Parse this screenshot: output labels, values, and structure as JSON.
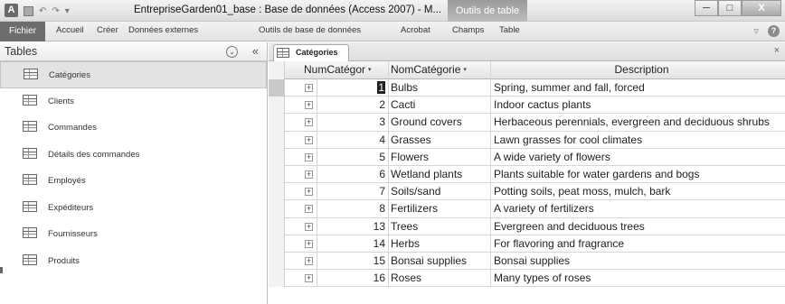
{
  "window": {
    "app_icon_letter": "A",
    "title": "EntrepriseGarden01_base : Base de données (Access 2007)  - M...",
    "context_tab_title": "Outils de table",
    "minimize": "─",
    "maximize": "□",
    "close": "X"
  },
  "ribbon": {
    "tabs": [
      {
        "label": "Fichier"
      },
      {
        "label": "Accueil"
      },
      {
        "label": "Créer"
      },
      {
        "label": "Données externes"
      },
      {
        "label": "Outils de base de données"
      },
      {
        "label": "Acrobat"
      },
      {
        "label": "Champs"
      },
      {
        "label": "Table"
      }
    ],
    "help_glyph": "?",
    "min_ribbon_glyph": "▿"
  },
  "nav": {
    "title": "Tables",
    "dropdown_glyph": "⌄",
    "collapse_glyph": "«",
    "items": [
      {
        "label": "Catégories"
      },
      {
        "label": "Clients"
      },
      {
        "label": "Commandes"
      },
      {
        "label": "Détails des commandes"
      },
      {
        "label": "Employés"
      },
      {
        "label": "Expéditeurs"
      },
      {
        "label": "Fournisseurs"
      },
      {
        "label": "Produits"
      }
    ]
  },
  "document": {
    "tab_label": "Catégories",
    "close_glyph": "×",
    "columns": {
      "num": "NumCatégor",
      "name": "NomCatégorie",
      "desc": "Description"
    },
    "sort_glyph": "▾",
    "expand_glyph": "+",
    "rows": [
      {
        "num": "1",
        "name": "Bulbs",
        "desc": "Spring, summer and fall, forced"
      },
      {
        "num": "2",
        "name": "Cacti",
        "desc": "Indoor cactus plants"
      },
      {
        "num": "3",
        "name": "Ground covers",
        "desc": "Herbaceous perennials, evergreen and deciduous shrubs"
      },
      {
        "num": "4",
        "name": "Grasses",
        "desc": "Lawn grasses for cool climates"
      },
      {
        "num": "5",
        "name": "Flowers",
        "desc": "A wide variety of flowers"
      },
      {
        "num": "6",
        "name": "Wetland plants",
        "desc": "Plants suitable for water gardens and bogs"
      },
      {
        "num": "7",
        "name": "Soils/sand",
        "desc": "Potting soils, peat moss, mulch, bark"
      },
      {
        "num": "8",
        "name": "Fertilizers",
        "desc": "A variety of fertilizers"
      },
      {
        "num": "13",
        "name": "Trees",
        "desc": "Evergreen and deciduous trees"
      },
      {
        "num": "14",
        "name": "Herbs",
        "desc": "For flavoring and fragrance"
      },
      {
        "num": "15",
        "name": "Bonsai supplies",
        "desc": "Bonsai supplies"
      },
      {
        "num": "16",
        "name": "Roses",
        "desc": "Many types of roses"
      }
    ]
  }
}
